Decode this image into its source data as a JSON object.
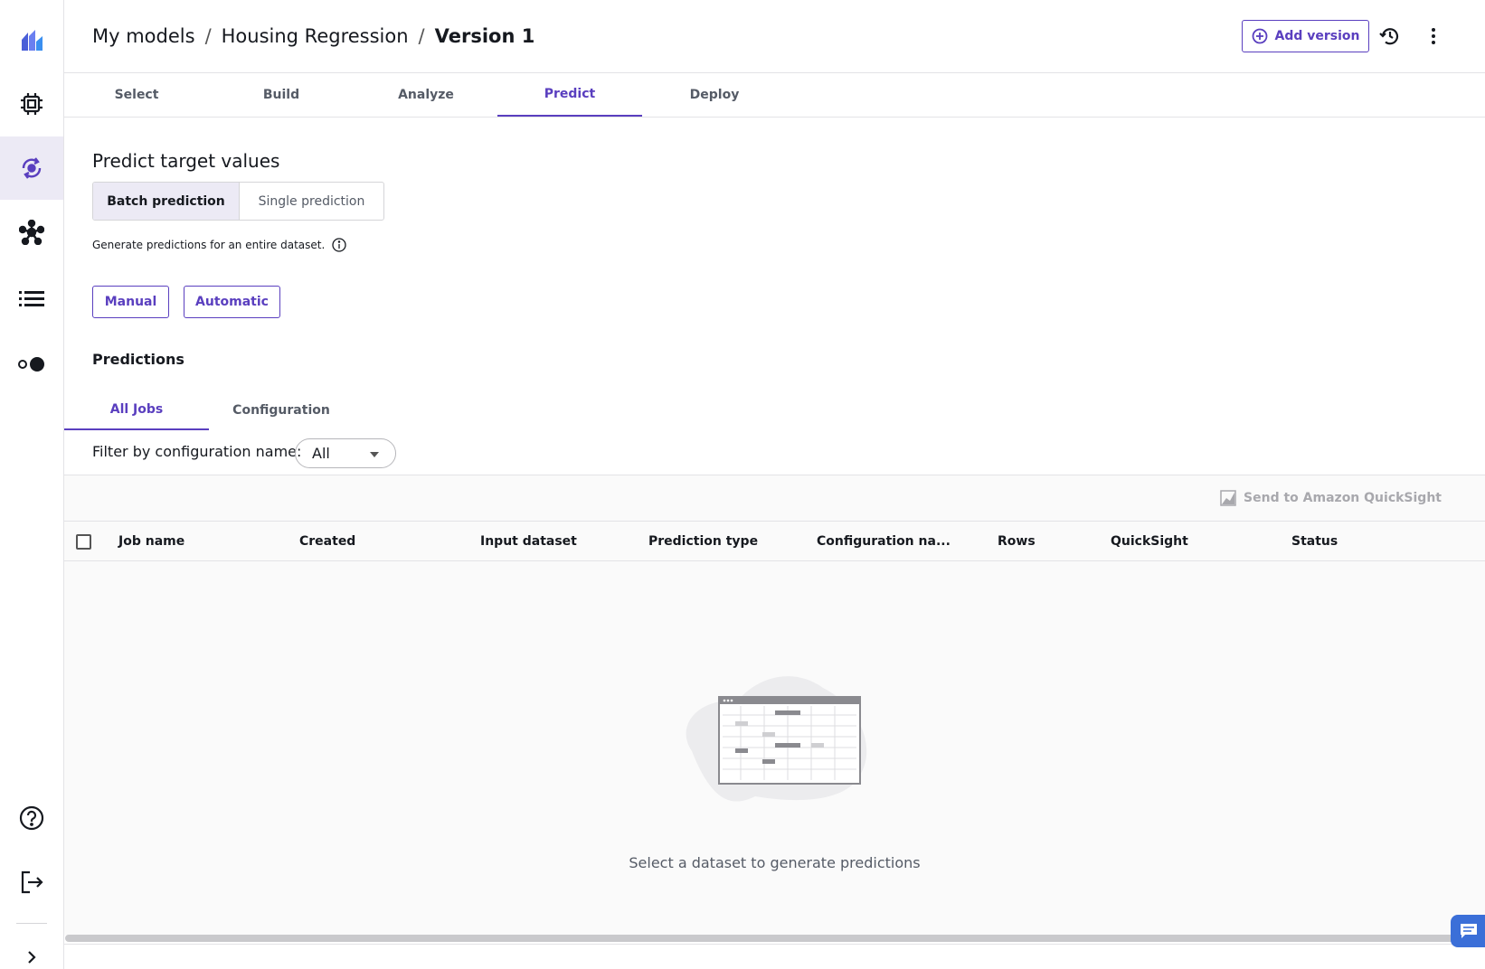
{
  "app": {
    "breadcrumb": [
      "My models",
      "Housing Regression",
      "Version 1"
    ],
    "breadcrumb_sep": "/",
    "add_version_label": "Add version",
    "accent_color": "#5a3fbf"
  },
  "rail": {
    "items": [
      "logo-icon",
      "chip-icon",
      "refresh-model-icon",
      "network-icon",
      "list-icon",
      "toggle-icon",
      "help-icon",
      "sign-out-icon",
      "expand-chevron-icon"
    ]
  },
  "tabs": [
    "Select",
    "Build",
    "Analyze",
    "Predict",
    "Deploy"
  ],
  "active_tab": "Predict",
  "predict": {
    "heading": "Predict target values",
    "mode_batch": "Batch prediction",
    "mode_single": "Single prediction",
    "description": "Generate predictions for an entire dataset.",
    "manual_label": "Manual",
    "automatic_label": "Automatic"
  },
  "predictions": {
    "heading": "Predictions",
    "subtabs": [
      "All Jobs",
      "Configuration"
    ],
    "filter_label": "Filter by configuration name:",
    "filter_value": "All",
    "send_label": "Send to Amazon QuickSight",
    "columns": [
      "Job name",
      "Created",
      "Input dataset",
      "Prediction type",
      "Configuration na...",
      "Rows",
      "QuickSight",
      "Status"
    ],
    "empty_text": "Select a dataset to generate predictions"
  }
}
